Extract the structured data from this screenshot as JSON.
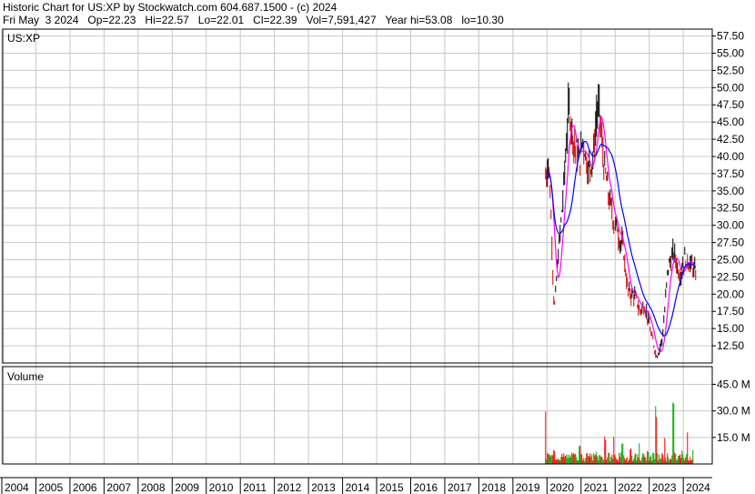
{
  "header": {
    "title_line": "Historic Chart for US:XP by Stockwatch.com 604.687.1500 - (c) 2024",
    "stats_line": "Fri May  3 2024   Op=22.23   Hi=22.57   Lo=22.01   Cl=22.39   Vol=7,591,427   Year hi=53.08   lo=10.30"
  },
  "price_panel": {
    "symbol": "US:XP",
    "y_ticks": [
      "57.50",
      "55.00",
      "52.50",
      "50.00",
      "47.50",
      "45.00",
      "42.50",
      "40.00",
      "37.50",
      "35.00",
      "32.50",
      "30.00",
      "27.50",
      "25.00",
      "22.50",
      "20.00",
      "17.50",
      "15.00",
      "12.50"
    ]
  },
  "volume_panel": {
    "label": "Volume",
    "y_ticks": [
      "45.0 M",
      "30.0 M",
      "15.0 M"
    ]
  },
  "x_axis": {
    "years": [
      "2004",
      "2005",
      "2006",
      "2007",
      "2008",
      "2009",
      "2010",
      "2011",
      "2012",
      "2013",
      "2014",
      "2015",
      "2016",
      "2017",
      "2018",
      "2019",
      "2020",
      "2021",
      "2022",
      "2023",
      "2024"
    ]
  },
  "colors": {
    "price_bar": "#000000",
    "price_bar_down": "#cc0000",
    "ma_short": "#ff00ff",
    "ma_long": "#0000ff",
    "volume_up": "#00aa00",
    "volume_down": "#ff0000",
    "grid": "#c8c8c8"
  },
  "chart_data": [
    {
      "type": "line",
      "title": "Historic Chart for US:XP",
      "ylim": [
        10,
        58.5
      ],
      "x": [
        "2019-12",
        "2020-01",
        "2020-03",
        "2020-04",
        "2020-06",
        "2020-08",
        "2020-10",
        "2020-12",
        "2021-01",
        "2021-03",
        "2021-05",
        "2021-06",
        "2021-07",
        "2021-08",
        "2021-10",
        "2021-12",
        "2022-01",
        "2022-03",
        "2022-05",
        "2022-07",
        "2022-09",
        "2022-11",
        "2023-01",
        "2023-03",
        "2023-05",
        "2023-07",
        "2023-09",
        "2023-11",
        "2024-01",
        "2024-03",
        "2024-05"
      ],
      "series": [
        {
          "values": [
            37.0,
            40.5,
            16.5,
            24.0,
            34.0,
            47.5,
            42.0,
            39.0,
            43.0,
            38.0,
            41.0,
            47.5,
            46.0,
            40.0,
            34.0,
            30.5,
            29.5,
            27.0,
            20.0,
            20.0,
            17.5,
            18.5,
            14.0,
            11.0,
            13.5,
            24.0,
            26.0,
            23.0,
            25.5,
            24.5,
            22.4
          ]
        }
      ]
    },
    {
      "type": "bar",
      "title": "Volume",
      "ylim": [
        0,
        55
      ],
      "x": [
        "2019-12",
        "2020-01",
        "2020-03",
        "2020-06",
        "2020-09",
        "2020-12",
        "2021-03",
        "2021-06",
        "2021-09",
        "2021-12",
        "2022-03",
        "2022-06",
        "2022-09",
        "2022-12",
        "2023-03",
        "2023-06",
        "2023-09",
        "2023-12",
        "2024-02",
        "2024-04"
      ],
      "values": [
        34.0,
        6.0,
        8.0,
        3.0,
        4.0,
        12.0,
        5.0,
        8.0,
        16.0,
        18.0,
        14.0,
        9.0,
        12.0,
        8.0,
        33.0,
        15.0,
        38.0,
        9.0,
        22.0,
        8.0
      ]
    }
  ]
}
